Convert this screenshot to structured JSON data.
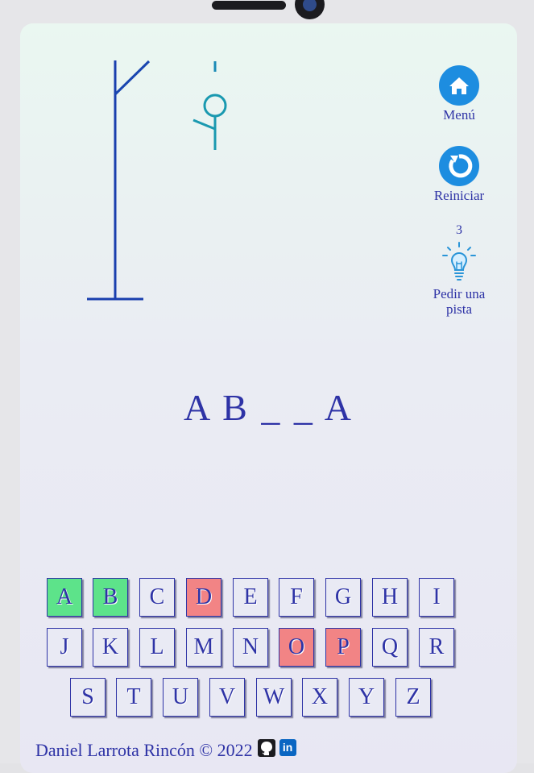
{
  "sidebar": {
    "menu_label": "Menú",
    "restart_label": "Reiniciar",
    "hint_count": "3",
    "hint_label_line1": "Pedir una",
    "hint_label_line2": "pista",
    "menu_icon": "home-icon",
    "restart_icon": "restart-icon",
    "hint_icon": "lightbulb-icon"
  },
  "game": {
    "word_display": "A B _ _ A",
    "hangman_parts_shown": [
      "head",
      "body",
      "left-arm"
    ]
  },
  "keyboard": {
    "row1": [
      {
        "letter": "A",
        "state": "correct"
      },
      {
        "letter": "B",
        "state": "correct"
      },
      {
        "letter": "C",
        "state": "unused"
      },
      {
        "letter": "D",
        "state": "wrong"
      },
      {
        "letter": "E",
        "state": "unused"
      },
      {
        "letter": "F",
        "state": "unused"
      },
      {
        "letter": "G",
        "state": "unused"
      },
      {
        "letter": "H",
        "state": "unused"
      },
      {
        "letter": "I",
        "state": "unused"
      }
    ],
    "row2": [
      {
        "letter": "J",
        "state": "unused"
      },
      {
        "letter": "K",
        "state": "unused"
      },
      {
        "letter": "L",
        "state": "unused"
      },
      {
        "letter": "M",
        "state": "unused"
      },
      {
        "letter": "N",
        "state": "unused"
      },
      {
        "letter": "O",
        "state": "wrong"
      },
      {
        "letter": "P",
        "state": "wrong"
      },
      {
        "letter": "Q",
        "state": "unused"
      },
      {
        "letter": "R",
        "state": "unused"
      }
    ],
    "row3": [
      {
        "letter": "S",
        "state": "unused"
      },
      {
        "letter": "T",
        "state": "unused"
      },
      {
        "letter": "U",
        "state": "unused"
      },
      {
        "letter": "V",
        "state": "unused"
      },
      {
        "letter": "W",
        "state": "unused"
      },
      {
        "letter": "X",
        "state": "unused"
      },
      {
        "letter": "Y",
        "state": "unused"
      },
      {
        "letter": "Z",
        "state": "unused"
      }
    ]
  },
  "footer": {
    "credit": "Daniel Larrota Rincón © 2022",
    "github_icon": "github-icon",
    "linkedin_icon": "linkedin-icon",
    "linkedin_text": "in"
  },
  "colors": {
    "primary": "#2e33a6",
    "correct": "#5de38a",
    "wrong": "#f28485",
    "icon_blue": "#1d8de0"
  }
}
